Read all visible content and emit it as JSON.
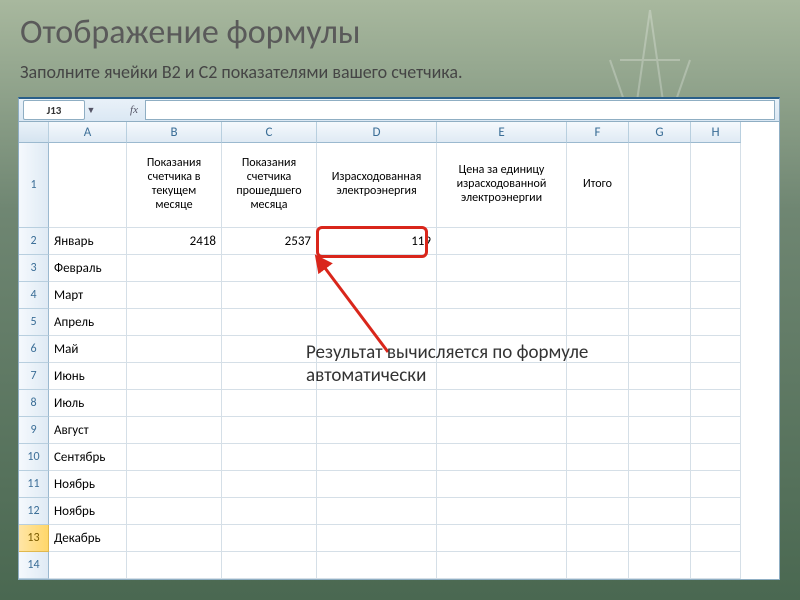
{
  "title": "Отображение формулы",
  "subtitle": "Заполните ячейки B2 и C2 показателями вашего счетчика.",
  "namebox": "J13",
  "columns": [
    "A",
    "B",
    "C",
    "D",
    "E",
    "F",
    "G",
    "H"
  ],
  "headers": {
    "B": "Показания счетчика в текущем месяце",
    "C": "Показания счетчика прошедшего месяца",
    "D": "Израсходованная электроэнергия",
    "E": "Цена за единицу израсходованной электроэнергии",
    "F": "Итого"
  },
  "rows": [
    {
      "n": 2,
      "A": "Январь",
      "B": "2418",
      "C": "2537",
      "D": "119"
    },
    {
      "n": 3,
      "A": "Февраль"
    },
    {
      "n": 4,
      "A": "Март"
    },
    {
      "n": 5,
      "A": "Апрель"
    },
    {
      "n": 6,
      "A": "Май"
    },
    {
      "n": 7,
      "A": "Июнь"
    },
    {
      "n": 8,
      "A": "Июль"
    },
    {
      "n": 9,
      "A": "Август"
    },
    {
      "n": 10,
      "A": "Сентябрь"
    },
    {
      "n": 11,
      "A": "Ноябрь"
    },
    {
      "n": 12,
      "A": "Ноябрь"
    },
    {
      "n": 13,
      "A": "Декабрь",
      "sel": true
    },
    {
      "n": 14,
      "A": ""
    }
  ],
  "callout1": "Результат вычисляется по формуле",
  "callout2": "автоматически"
}
